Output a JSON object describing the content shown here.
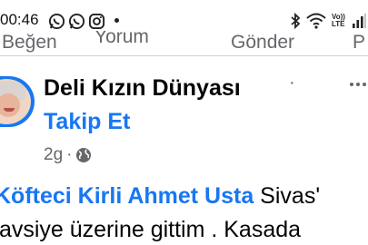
{
  "status_bar": {
    "time": "00:46",
    "notification_icons": [
      "whatsapp-icon",
      "whatsapp-icon",
      "instagram-icon"
    ],
    "system_icons": [
      "bluetooth-icon",
      "wifi-icon",
      "volte-icon",
      "signal-icon"
    ],
    "volte_label": "Vo)) LTE"
  },
  "actions": {
    "like": "Beğen",
    "comment": "Yorum",
    "send": "Gönder",
    "share": "P"
  },
  "post": {
    "page_name": "Deli Kızın Dünyası",
    "name_separator": "·",
    "follow": "Takip Et",
    "time": "2g",
    "time_separator": "·",
    "privacy_icon": "globe-icon",
    "text_line1_mention": "Köfteci Kirli Ahmet Usta",
    "text_line1_rest": " Sivas'",
    "text_line2": "tavsiye üzerine gittim  . Kasada"
  },
  "colors": {
    "link_blue": "#1877f2",
    "secondary_text": "#65676b",
    "primary_text": "#050505"
  }
}
